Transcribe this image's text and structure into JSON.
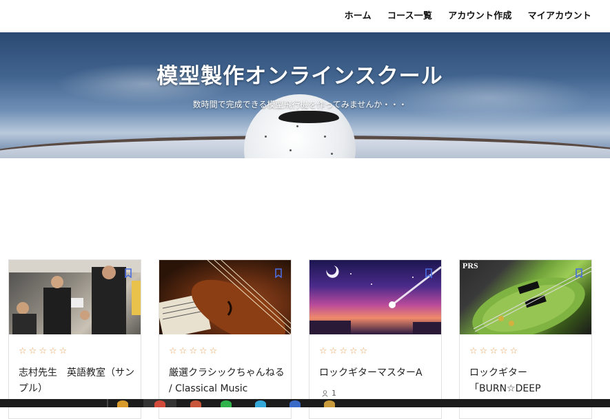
{
  "nav": {
    "items": [
      {
        "label": "ホーム"
      },
      {
        "label": "コース一覧"
      },
      {
        "label": "アカウント作成"
      },
      {
        "label": "マイアカウント"
      }
    ]
  },
  "hero": {
    "title": "模型製作オンラインスクール",
    "subtitle": "数時間で完成できる模型飛行機を作ってみませんか・・・"
  },
  "courses": [
    {
      "title": "志村先生　英語教室（サンプル）",
      "rating": 0,
      "students": "",
      "thumbnail": "classroom-photo"
    },
    {
      "title": "厳選クラシックちゃんねる / Classical Music",
      "rating": 0,
      "students": "",
      "thumbnail": "violin-photo"
    },
    {
      "title": "ロックギターマスターA",
      "rating": 0,
      "students": "1",
      "thumbnail": "space-photo"
    },
    {
      "title": "ロックギター「BURN☆DEEP",
      "rating": 0,
      "students": "",
      "thumbnail": "guitar-photo"
    }
  ],
  "colors": {
    "star": "#e8a35a",
    "bookmark": "#4a6ee0"
  }
}
